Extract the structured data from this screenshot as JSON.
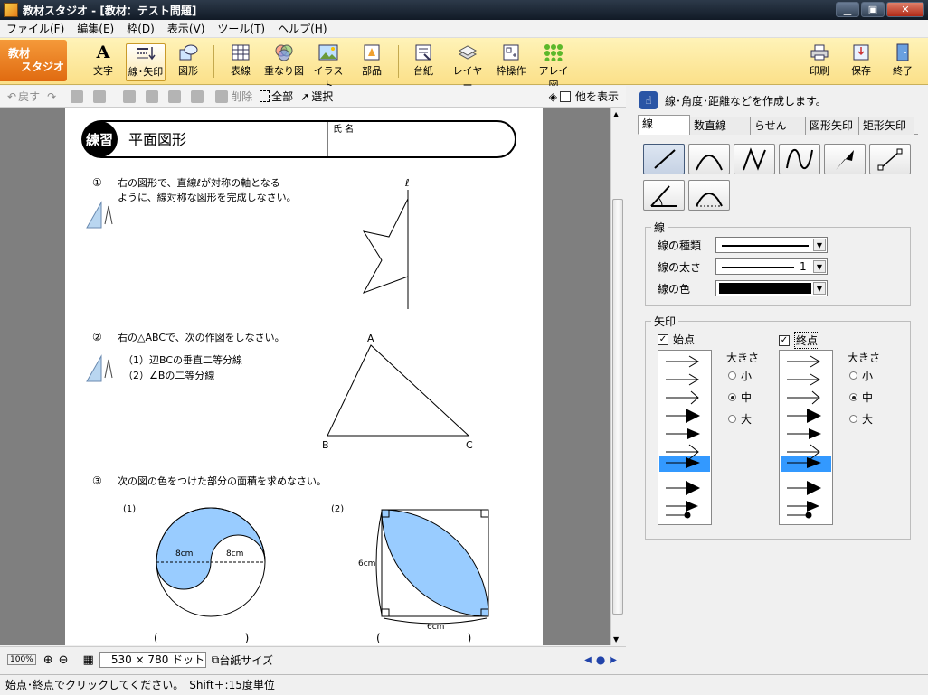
{
  "window": {
    "title": "教材スタジオ - [教材：テスト問題]"
  },
  "menu": [
    "ファイル(F)",
    "編集(E)",
    "枠(D)",
    "表示(V)",
    "ツール(T)",
    "ヘルプ(H)"
  ],
  "brand": {
    "line1": "教材",
    "line2": "スタジオ"
  },
  "toolbar": {
    "tools": [
      "文字",
      "線･矢印",
      "図形",
      "表線",
      "重なり図",
      "イラスト",
      "部品",
      "台紙",
      "レイヤー",
      "枠操作",
      "アレイ図"
    ],
    "right": [
      "印刷",
      "保存",
      "終了"
    ]
  },
  "docbar": {
    "undo": "戻す",
    "delete": "削除",
    "all": "全部",
    "select": "選択",
    "show_others": "他を表示"
  },
  "worksheet": {
    "badge": "練習",
    "title": "平面図形",
    "name_label": "氏 名",
    "q1": {
      "num": "①",
      "line1": "右の図形で、直線ℓが対称の軸となる",
      "line2": "ように、線対称な図形を完成しなさい。",
      "axis": "ℓ"
    },
    "q2": {
      "num": "②",
      "line1": "右の△ABCで、次の作図をしなさい。",
      "sub1": "（1）辺BCの垂直二等分線",
      "sub2": "（2）∠Bの二等分線",
      "A": "A",
      "B": "B",
      "C": "C"
    },
    "q3": {
      "num": "③",
      "line1": "次の図の色をつけた部分の面積を求めなさい。",
      "p1": "(1)",
      "p2": "(2)",
      "len1": "8cm",
      "len2": "8cm",
      "len3": "6cm",
      "len4": "6cm",
      "paren": "(　　　　　　　　)"
    }
  },
  "status": {
    "size": "530 × 780 ドット",
    "paper_size": "台紙サイズ",
    "hint": "始点･終点でクリックしてください。　Shift＋:15度単位"
  },
  "panel": {
    "hint": "線･角度･距離などを作成します。",
    "tabs": [
      "線",
      "数直線",
      "らせん",
      "図形矢印",
      "矩形矢印"
    ],
    "line_group": "線",
    "line_type": "線の種類",
    "line_width": "線の太さ",
    "line_width_value": "1",
    "line_color": "線の色",
    "arrow_group": "矢印",
    "start": "始点",
    "end": "終点",
    "size": "大きさ",
    "sizes": [
      "小",
      "中",
      "大"
    ],
    "colors": {
      "highlight": "#3399ff",
      "fill": "#99ccff",
      "brand": "#e97a1c"
    }
  }
}
